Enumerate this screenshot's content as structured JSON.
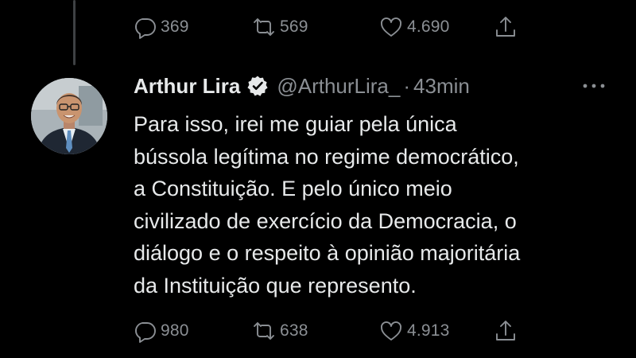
{
  "prev_tweet": {
    "actions": {
      "reply_count": "369",
      "retweet_count": "569",
      "like_count": "4.690"
    }
  },
  "tweet": {
    "author": {
      "display_name": "Arthur Lira",
      "handle": "@ArthurLira_",
      "verified": true
    },
    "separator": "·",
    "time": "43min",
    "text_lines": [
      "Para isso, irei me guiar pela única",
      "bússola legítima no regime democrático,",
      "a Constituição. E pelo único meio",
      "civilizado de exercício da Democracia, o",
      "diálogo e o respeito à opinião majoritária",
      "da Instituição que represento."
    ],
    "actions": {
      "reply_count": "980",
      "retweet_count": "638",
      "like_count": "4.913"
    }
  },
  "icons": {
    "reply": "comment-bubble-icon",
    "retweet": "retweet-arrows-icon",
    "like": "heart-icon",
    "share": "share-upload-icon",
    "more": "more-dots-icon",
    "verified": "verified-badge-icon"
  },
  "colors": {
    "background": "#000000",
    "text_primary": "#e7e9ea",
    "text_secondary": "#8b8f94",
    "thread_line": "#3e4144"
  }
}
